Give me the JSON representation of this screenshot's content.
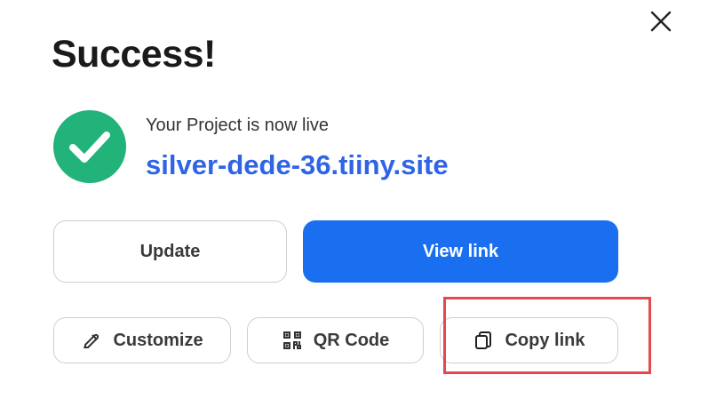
{
  "dialog": {
    "title": "Success!",
    "status_text": "Your Project is now live",
    "site_url": "silver-dede-36.tiiny.site"
  },
  "actions": {
    "update_label": "Update",
    "view_link_label": "View link",
    "customize_label": "Customize",
    "qr_code_label": "QR Code",
    "copy_link_label": "Copy link"
  },
  "icons": {
    "close": "close-icon",
    "status": "check-circle-icon",
    "customize": "pencil-edit-icon",
    "qr": "qr-code-icon",
    "copy": "copy-icon"
  },
  "colors": {
    "success": "#21b37a",
    "link": "#2f64e6",
    "primary": "#1a6ff0",
    "highlight": "#e8474f"
  }
}
